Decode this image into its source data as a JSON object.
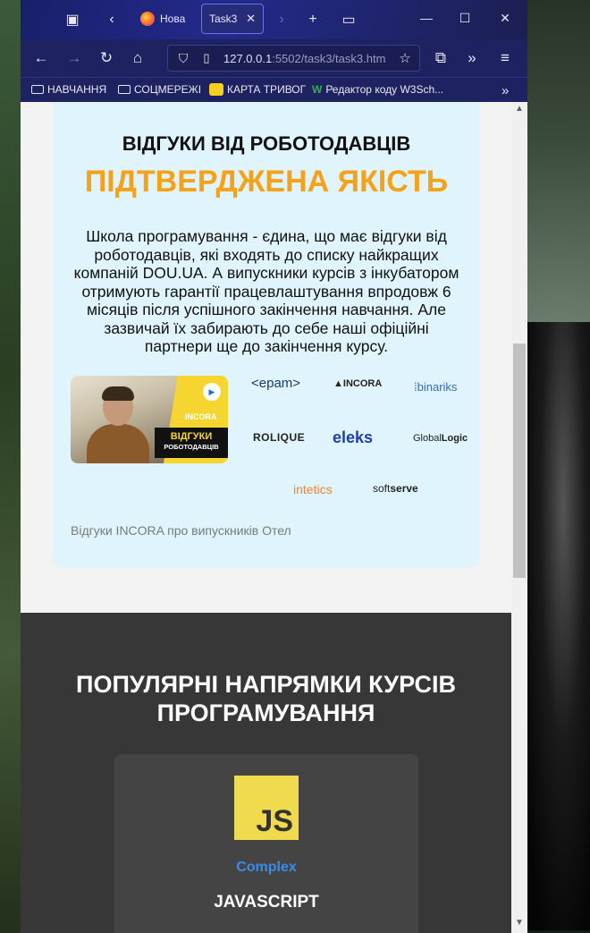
{
  "browser": {
    "tabs": [
      {
        "label": "Нова",
        "active": false
      },
      {
        "label": "Task3",
        "active": true
      }
    ],
    "url": {
      "host": "127.0.0.1",
      "rest": ":5502/task3/task3.htm"
    },
    "bookmarks": [
      {
        "label": "НАВЧАННЯ",
        "icon": "folder-icon"
      },
      {
        "label": "СОЦМЕРЕЖІ",
        "icon": "folder-icon"
      },
      {
        "label": "КАРТА ТРИВОГ",
        "icon": "map-icon"
      },
      {
        "label": "Редактор коду W3Sch...",
        "icon": "w3schools-icon"
      }
    ]
  },
  "reviews": {
    "title": "ВІДГУКИ ВІД РОБОТОДАВЦІВ",
    "subtitle": "ПІДТВЕРДЖЕНА ЯКІСТЬ",
    "body": "Школа програмування - єдина, що має відгуки від роботодавців, які входять до списку найкращих компаній DOU.UA. А випускники курсів з інкубатором отримують гарантії працевлаштування впродовж 6 місяців після успішного закінчення навчання. Але зазвичай їх забирають до себе наші офіційні партнери ще до закінчення курсу.",
    "video": {
      "brand": "INCORA",
      "label_top": "ВІДГУКИ",
      "label_bottom": "РОБОТОДАВЦІВ"
    },
    "logos": {
      "epam": "<epam>",
      "incora": "INCORA",
      "binariks": "binariks",
      "rolique": "ROLIQUE",
      "eleks": "eleks",
      "globallogic_a": "Global",
      "globallogic_b": "Logic",
      "intetics": "intetics",
      "softserve_a": "soft",
      "softserve_b": "serve"
    },
    "caption": "Відгуки INCORA про випускників Отел"
  },
  "courses": {
    "title_line1": "ПОПУЛЯРНІ НАПРЯМКИ КУРСІВ",
    "title_line2": "ПРОГРАМУВАННЯ",
    "card": {
      "logo_text": "JS",
      "level": "Complex",
      "name": "JAVASCRIPT"
    }
  },
  "colors": {
    "accent": "#f5a11a",
    "link": "#3a8ce8",
    "review_bg": "#dff4fc",
    "dark_bg": "#373737"
  }
}
